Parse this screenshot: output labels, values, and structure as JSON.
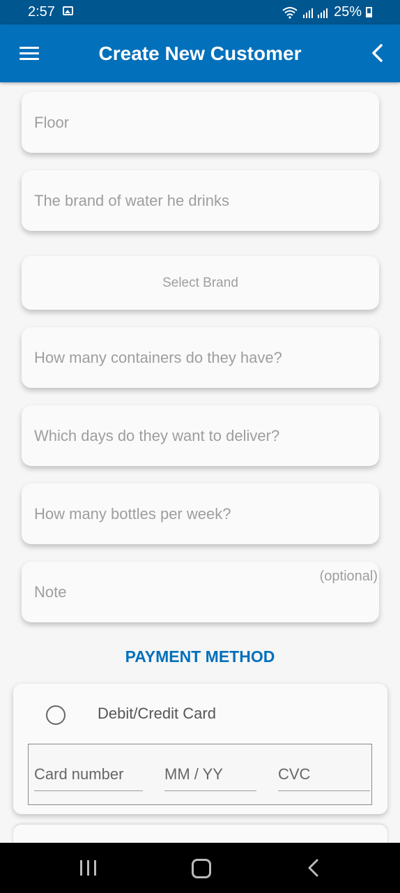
{
  "status_bar": {
    "time": "2:57",
    "battery": "25%",
    "icons": [
      "image-icon",
      "wifi-icon",
      "signal-icon",
      "battery-icon"
    ]
  },
  "app_bar": {
    "title": "Create New Customer",
    "menu_icon": "menu-icon",
    "back_icon": "chevron-left-icon"
  },
  "form": {
    "floor_placeholder": "Floor",
    "brand_placeholder": "The brand of water he drinks",
    "select_brand_label": "Select Brand",
    "containers_placeholder": "How many containers do they have?",
    "delivery_days_placeholder": "Which days do they want to deliver?",
    "bottles_placeholder": "How many bottles per week?",
    "note_placeholder": "Note",
    "note_optional": "(optional)"
  },
  "payment": {
    "section_title": "PAYMENT METHOD",
    "option_label": "Debit/Credit Card",
    "card_number_placeholder": "Card number",
    "expiry_placeholder": "MM / YY",
    "cvc_placeholder": "CVC"
  },
  "colors": {
    "primary": "#0270bb",
    "status_bar": "#00568f",
    "background": "#f6f6f6",
    "placeholder": "#9e9e9e"
  }
}
